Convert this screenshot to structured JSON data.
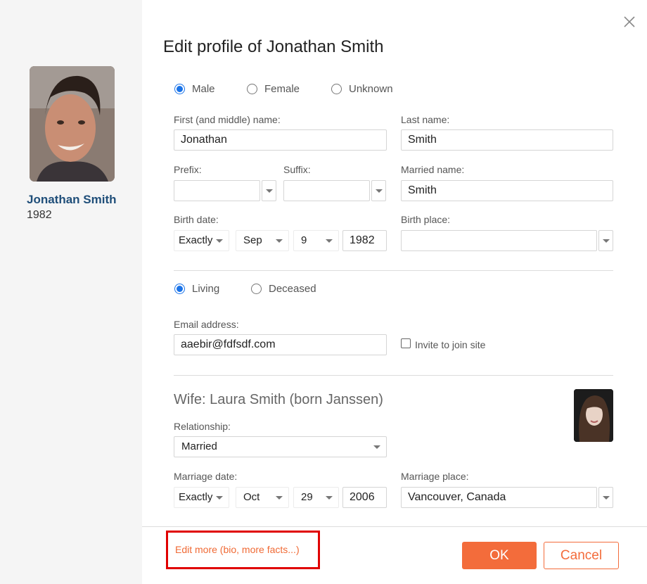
{
  "sidebar": {
    "name": "Jonathan Smith",
    "year": "1982"
  },
  "dialog": {
    "title": "Edit profile of Jonathan Smith",
    "close_icon": "close-icon"
  },
  "gender": {
    "options": [
      "Male",
      "Female",
      "Unknown"
    ],
    "selected": "Male"
  },
  "fields": {
    "first_name_label": "First (and middle) name:",
    "first_name_value": "Jonathan",
    "last_name_label": "Last name:",
    "last_name_value": "Smith",
    "prefix_label": "Prefix:",
    "prefix_value": "",
    "suffix_label": "Suffix:",
    "suffix_value": "",
    "married_name_label": "Married name:",
    "married_name_value": "Smith",
    "birth_date_label": "Birth date:",
    "birth_qualifier": "Exactly",
    "birth_month": "Sep",
    "birth_day": "9",
    "birth_year": "1982",
    "birth_place_label": "Birth place:",
    "birth_place_value": ""
  },
  "status": {
    "options": [
      "Living",
      "Deceased"
    ],
    "selected": "Living"
  },
  "email": {
    "label": "Email address:",
    "value": "aaebir@fdfsdf.com",
    "invite_label": "Invite to join site",
    "invite_checked": false
  },
  "spouse": {
    "title": "Wife: Laura Smith (born Janssen)",
    "relationship_label": "Relationship:",
    "relationship_value": "Married",
    "marriage_date_label": "Marriage date:",
    "marriage_qualifier": "Exactly",
    "marriage_month": "Oct",
    "marriage_day": "29",
    "marriage_year": "2006",
    "marriage_place_label": "Marriage place:",
    "marriage_place_value": "Vancouver, Canada"
  },
  "footer": {
    "edit_more": "Edit more (bio, more facts...)",
    "ok": "OK",
    "cancel": "Cancel"
  },
  "colors": {
    "accent": "#f36c3b",
    "radio": "#1a73e8",
    "name": "#1f4e79",
    "highlight": "#e00000"
  }
}
